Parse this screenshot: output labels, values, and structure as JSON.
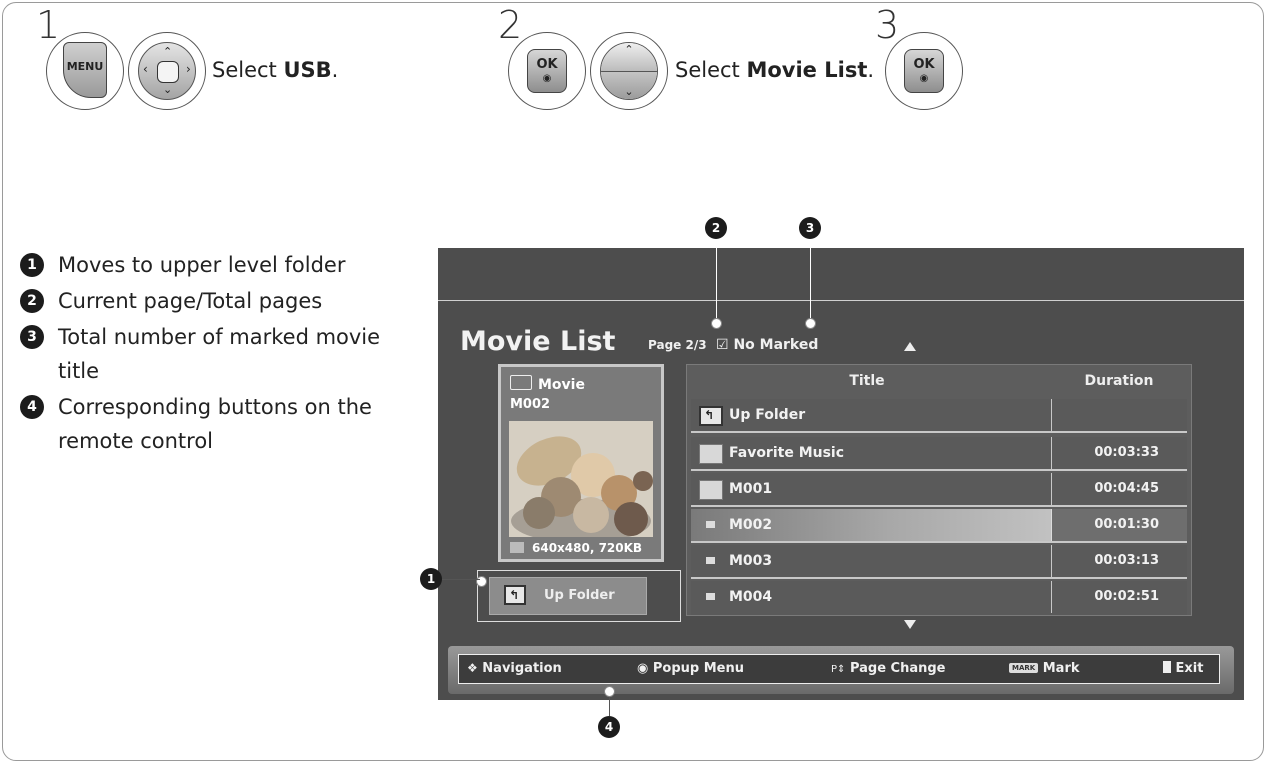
{
  "steps": [
    {
      "number": "1",
      "text_prefix": "Select ",
      "text_bold": "USB",
      "text_suffix": ".",
      "buttons": [
        "MENU",
        "navigation-pad"
      ]
    },
    {
      "number": "2",
      "text_prefix": "Select ",
      "text_bold": "Movie List",
      "text_suffix": ".",
      "buttons": [
        "OK",
        "up-down"
      ]
    },
    {
      "number": "3",
      "buttons": [
        "OK"
      ]
    }
  ],
  "remote": {
    "menu_label": "MENU",
    "ok_label": "OK",
    "ok_dot": "◉"
  },
  "legend": [
    {
      "num": "1",
      "text": "Moves to upper level folder"
    },
    {
      "num": "2",
      "text": "Current page/Total pages"
    },
    {
      "num": "3",
      "text": "Total number of marked movie title"
    },
    {
      "num": "4",
      "text": "Corresponding buttons on the remote control"
    }
  ],
  "screen": {
    "title": "Movie List",
    "page_info": "Page 2/3",
    "marked_icon": "☑",
    "marked_text": "No Marked",
    "preview": {
      "folder_label": "Movie",
      "file_name": "M002",
      "image_info": "640x480, 720KB",
      "image_subject": "fruit-bowl"
    },
    "up_folder_label": "Up Folder",
    "table": {
      "headers": {
        "title": "Title",
        "duration": "Duration"
      },
      "rows": [
        {
          "title": "Up Folder",
          "duration": "",
          "icon": "up-folder-icon"
        },
        {
          "title": "Favorite Music",
          "duration": "00:03:33",
          "icon": "folder-icon"
        },
        {
          "title": "M001",
          "duration": "00:04:45",
          "icon": "folder-icon"
        },
        {
          "title": "M002",
          "duration": "00:01:30",
          "icon": "file-icon",
          "selected": true
        },
        {
          "title": "M003",
          "duration": "00:03:13",
          "icon": "file-icon"
        },
        {
          "title": "M004",
          "duration": "00:02:51",
          "icon": "file-icon"
        }
      ]
    },
    "navbar": {
      "navigation": "Navigation",
      "popup_menu": "Popup Menu",
      "page_change_prefix": "P",
      "page_change": "Page Change",
      "mark_badge": "MARK",
      "mark": "Mark",
      "exit": "Exit"
    }
  },
  "callouts": [
    "1",
    "2",
    "3",
    "4"
  ],
  "colors": {
    "screen_bg": "#4d4d4d",
    "callout_bg": "#1c1c1c",
    "selected_row": "#cfcfcf"
  }
}
